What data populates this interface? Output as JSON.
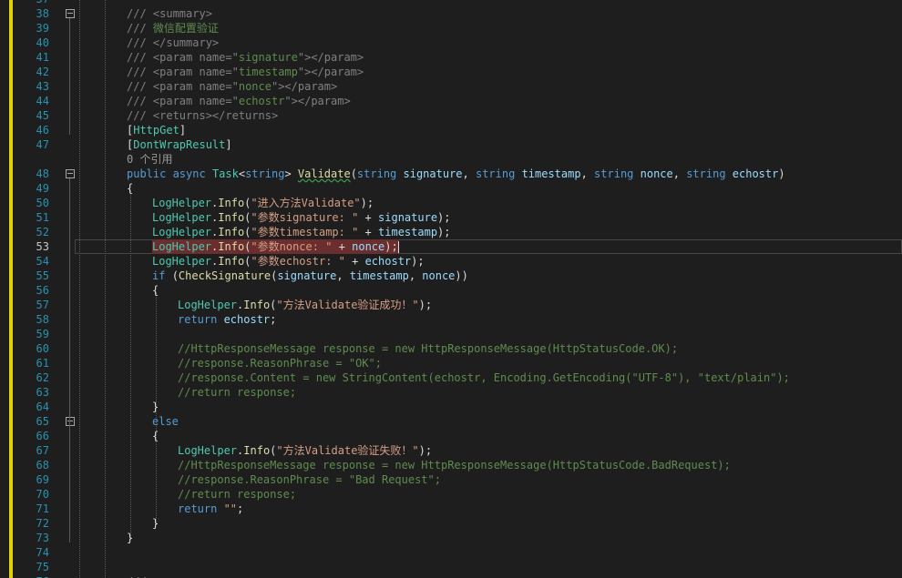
{
  "editor": {
    "language": "C#",
    "current_line": 53,
    "lines": [
      {
        "num": "37",
        "indent": 2,
        "segments": []
      },
      {
        "num": "38",
        "indent": 2,
        "fold": true,
        "segments": [
          {
            "t": "/// ",
            "c": "c-doctag"
          },
          {
            "t": "<summary>",
            "c": "c-doctag"
          }
        ]
      },
      {
        "num": "39",
        "indent": 2,
        "segments": [
          {
            "t": "/// ",
            "c": "c-doctag"
          },
          {
            "t": "微信配置验证",
            "c": "c-doc"
          }
        ]
      },
      {
        "num": "40",
        "indent": 2,
        "segments": [
          {
            "t": "/// ",
            "c": "c-doctag"
          },
          {
            "t": "</summary>",
            "c": "c-doctag"
          }
        ]
      },
      {
        "num": "41",
        "indent": 2,
        "segments": [
          {
            "t": "/// ",
            "c": "c-doctag"
          },
          {
            "t": "<param ",
            "c": "c-doctag"
          },
          {
            "t": "name=",
            "c": "c-doctag"
          },
          {
            "t": "\"",
            "c": "c-doctag"
          },
          {
            "t": "signature",
            "c": "c-doc"
          },
          {
            "t": "\"",
            "c": "c-doctag"
          },
          {
            "t": "></param>",
            "c": "c-doctag"
          }
        ]
      },
      {
        "num": "42",
        "indent": 2,
        "segments": [
          {
            "t": "/// ",
            "c": "c-doctag"
          },
          {
            "t": "<param ",
            "c": "c-doctag"
          },
          {
            "t": "name=",
            "c": "c-doctag"
          },
          {
            "t": "\"",
            "c": "c-doctag"
          },
          {
            "t": "timestamp",
            "c": "c-doc"
          },
          {
            "t": "\"",
            "c": "c-doctag"
          },
          {
            "t": "></param>",
            "c": "c-doctag"
          }
        ]
      },
      {
        "num": "43",
        "indent": 2,
        "segments": [
          {
            "t": "/// ",
            "c": "c-doctag"
          },
          {
            "t": "<param ",
            "c": "c-doctag"
          },
          {
            "t": "name=",
            "c": "c-doctag"
          },
          {
            "t": "\"",
            "c": "c-doctag"
          },
          {
            "t": "nonce",
            "c": "c-doc"
          },
          {
            "t": "\"",
            "c": "c-doctag"
          },
          {
            "t": "></param>",
            "c": "c-doctag"
          }
        ]
      },
      {
        "num": "44",
        "indent": 2,
        "segments": [
          {
            "t": "/// ",
            "c": "c-doctag"
          },
          {
            "t": "<param ",
            "c": "c-doctag"
          },
          {
            "t": "name=",
            "c": "c-doctag"
          },
          {
            "t": "\"",
            "c": "c-doctag"
          },
          {
            "t": "echostr",
            "c": "c-doc"
          },
          {
            "t": "\"",
            "c": "c-doctag"
          },
          {
            "t": "></param>",
            "c": "c-doctag"
          }
        ]
      },
      {
        "num": "45",
        "indent": 2,
        "segments": [
          {
            "t": "/// ",
            "c": "c-doctag"
          },
          {
            "t": "<returns></returns>",
            "c": "c-doctag"
          }
        ]
      },
      {
        "num": "46",
        "indent": 2,
        "segments": [
          {
            "t": "[",
            "c": "c-text"
          },
          {
            "t": "HttpGet",
            "c": "c-attr"
          },
          {
            "t": "]",
            "c": "c-text"
          }
        ]
      },
      {
        "num": "47",
        "indent": 2,
        "segments": [
          {
            "t": "[",
            "c": "c-text"
          },
          {
            "t": "DontWrapResult",
            "c": "c-attr"
          },
          {
            "t": "]",
            "c": "c-text"
          }
        ]
      },
      {
        "num": "",
        "indent": 2,
        "lens": true,
        "segments": [
          {
            "t": "0 个引用",
            "c": "c-lens"
          }
        ]
      },
      {
        "num": "48",
        "indent": 2,
        "fold": true,
        "segments": [
          {
            "t": "public ",
            "c": "c-keyword"
          },
          {
            "t": "async ",
            "c": "c-keyword"
          },
          {
            "t": "Task",
            "c": "c-type"
          },
          {
            "t": "<",
            "c": "c-text"
          },
          {
            "t": "string",
            "c": "c-keyword"
          },
          {
            "t": "> ",
            "c": "c-text"
          },
          {
            "t": "Validate",
            "c": "c-method",
            "sq": true
          },
          {
            "t": "(",
            "c": "c-text"
          },
          {
            "t": "string ",
            "c": "c-keyword"
          },
          {
            "t": "signature",
            "c": "c-ident"
          },
          {
            "t": ", ",
            "c": "c-text"
          },
          {
            "t": "string ",
            "c": "c-keyword"
          },
          {
            "t": "timestamp",
            "c": "c-ident"
          },
          {
            "t": ", ",
            "c": "c-text"
          },
          {
            "t": "string ",
            "c": "c-keyword"
          },
          {
            "t": "nonce",
            "c": "c-ident"
          },
          {
            "t": ", ",
            "c": "c-text"
          },
          {
            "t": "string ",
            "c": "c-keyword"
          },
          {
            "t": "echostr",
            "c": "c-ident"
          },
          {
            "t": ")",
            "c": "c-text"
          }
        ]
      },
      {
        "num": "49",
        "indent": 2,
        "segments": [
          {
            "t": "{",
            "c": "c-text"
          }
        ]
      },
      {
        "num": "50",
        "indent": 3,
        "segments": [
          {
            "t": "LogHelper",
            "c": "c-type"
          },
          {
            "t": ".",
            "c": "c-text"
          },
          {
            "t": "Info",
            "c": "c-method"
          },
          {
            "t": "(",
            "c": "c-text"
          },
          {
            "t": "\"进入方法Validate\"",
            "c": "c-string"
          },
          {
            "t": ");",
            "c": "c-text"
          }
        ]
      },
      {
        "num": "51",
        "indent": 3,
        "segments": [
          {
            "t": "LogHelper",
            "c": "c-type"
          },
          {
            "t": ".",
            "c": "c-text"
          },
          {
            "t": "Info",
            "c": "c-method"
          },
          {
            "t": "(",
            "c": "c-text"
          },
          {
            "t": "\"参数signature: \"",
            "c": "c-string"
          },
          {
            "t": " + ",
            "c": "c-text"
          },
          {
            "t": "signature",
            "c": "c-ident"
          },
          {
            "t": ");",
            "c": "c-text"
          }
        ]
      },
      {
        "num": "52",
        "indent": 3,
        "segments": [
          {
            "t": "LogHelper",
            "c": "c-type"
          },
          {
            "t": ".",
            "c": "c-text"
          },
          {
            "t": "Info",
            "c": "c-method"
          },
          {
            "t": "(",
            "c": "c-text"
          },
          {
            "t": "\"参数timestamp: \"",
            "c": "c-string"
          },
          {
            "t": " + ",
            "c": "c-text"
          },
          {
            "t": "timestamp",
            "c": "c-ident"
          },
          {
            "t": ");",
            "c": "c-text"
          }
        ]
      },
      {
        "num": "53",
        "indent": 3,
        "current": true,
        "segments": [
          {
            "t": "LogHelper",
            "c": "c-type"
          },
          {
            "t": ".",
            "c": "c-text"
          },
          {
            "t": "Info",
            "c": "c-method"
          },
          {
            "t": "(",
            "c": "c-text"
          },
          {
            "t": "\"参数nonce: \"",
            "c": "c-string"
          },
          {
            "t": " + ",
            "c": "c-text"
          },
          {
            "t": "nonce",
            "c": "c-ident"
          },
          {
            "t": ");",
            "c": "c-text"
          }
        ]
      },
      {
        "num": "54",
        "indent": 3,
        "segments": [
          {
            "t": "LogHelper",
            "c": "c-type"
          },
          {
            "t": ".",
            "c": "c-text"
          },
          {
            "t": "Info",
            "c": "c-method"
          },
          {
            "t": "(",
            "c": "c-text"
          },
          {
            "t": "\"参数echostr: \"",
            "c": "c-string"
          },
          {
            "t": " + ",
            "c": "c-text"
          },
          {
            "t": "echostr",
            "c": "c-ident"
          },
          {
            "t": ");",
            "c": "c-text"
          }
        ]
      },
      {
        "num": "55",
        "indent": 3,
        "segments": [
          {
            "t": "if ",
            "c": "c-keyword"
          },
          {
            "t": "(",
            "c": "c-text"
          },
          {
            "t": "CheckSignature",
            "c": "c-method"
          },
          {
            "t": "(",
            "c": "c-text"
          },
          {
            "t": "signature",
            "c": "c-ident"
          },
          {
            "t": ", ",
            "c": "c-text"
          },
          {
            "t": "timestamp",
            "c": "c-ident"
          },
          {
            "t": ", ",
            "c": "c-text"
          },
          {
            "t": "nonce",
            "c": "c-ident"
          },
          {
            "t": "))",
            "c": "c-text"
          }
        ]
      },
      {
        "num": "56",
        "indent": 3,
        "segments": [
          {
            "t": "{",
            "c": "c-text"
          }
        ]
      },
      {
        "num": "57",
        "indent": 4,
        "segments": [
          {
            "t": "LogHelper",
            "c": "c-type"
          },
          {
            "t": ".",
            "c": "c-text"
          },
          {
            "t": "Info",
            "c": "c-method"
          },
          {
            "t": "(",
            "c": "c-text"
          },
          {
            "t": "\"方法Validate验证成功！\"",
            "c": "c-string"
          },
          {
            "t": ");",
            "c": "c-text"
          }
        ]
      },
      {
        "num": "58",
        "indent": 4,
        "segments": [
          {
            "t": "return ",
            "c": "c-keyword"
          },
          {
            "t": "echostr",
            "c": "c-ident"
          },
          {
            "t": ";",
            "c": "c-text"
          }
        ]
      },
      {
        "num": "59",
        "indent": 4,
        "segments": []
      },
      {
        "num": "60",
        "indent": 4,
        "segments": [
          {
            "t": "//HttpResponseMessage response = new HttpResponseMessage(HttpStatusCode.OK);",
            "c": "c-comment"
          }
        ]
      },
      {
        "num": "61",
        "indent": 4,
        "segments": [
          {
            "t": "//response.ReasonPhrase = \"OK\";",
            "c": "c-comment"
          }
        ]
      },
      {
        "num": "62",
        "indent": 4,
        "segments": [
          {
            "t": "//response.Content = new StringContent(echostr, Encoding.GetEncoding(\"UTF-8\"), \"text/plain\");",
            "c": "c-comment"
          }
        ]
      },
      {
        "num": "63",
        "indent": 4,
        "segments": [
          {
            "t": "//return response;",
            "c": "c-comment"
          }
        ]
      },
      {
        "num": "64",
        "indent": 3,
        "segments": [
          {
            "t": "}",
            "c": "c-text"
          }
        ]
      },
      {
        "num": "65",
        "indent": 3,
        "fold": true,
        "segments": [
          {
            "t": "else",
            "c": "c-keyword"
          }
        ]
      },
      {
        "num": "66",
        "indent": 3,
        "segments": [
          {
            "t": "{",
            "c": "c-text"
          }
        ]
      },
      {
        "num": "67",
        "indent": 4,
        "segments": [
          {
            "t": "LogHelper",
            "c": "c-type"
          },
          {
            "t": ".",
            "c": "c-text"
          },
          {
            "t": "Info",
            "c": "c-method"
          },
          {
            "t": "(",
            "c": "c-text"
          },
          {
            "t": "\"方法Validate验证失败！\"",
            "c": "c-string"
          },
          {
            "t": ");",
            "c": "c-text"
          }
        ]
      },
      {
        "num": "68",
        "indent": 4,
        "segments": [
          {
            "t": "//HttpResponseMessage response = new HttpResponseMessage(HttpStatusCode.BadRequest);",
            "c": "c-comment"
          }
        ]
      },
      {
        "num": "69",
        "indent": 4,
        "segments": [
          {
            "t": "//response.ReasonPhrase = \"Bad Request\";",
            "c": "c-comment"
          }
        ]
      },
      {
        "num": "70",
        "indent": 4,
        "segments": [
          {
            "t": "//return response;",
            "c": "c-comment"
          }
        ]
      },
      {
        "num": "71",
        "indent": 4,
        "segments": [
          {
            "t": "return ",
            "c": "c-keyword"
          },
          {
            "t": "\"\"",
            "c": "c-string"
          },
          {
            "t": ";",
            "c": "c-text"
          }
        ]
      },
      {
        "num": "72",
        "indent": 3,
        "segments": [
          {
            "t": "}",
            "c": "c-text"
          }
        ]
      },
      {
        "num": "73",
        "indent": 2,
        "segments": [
          {
            "t": "}",
            "c": "c-text"
          }
        ]
      },
      {
        "num": "74",
        "indent": 2,
        "segments": []
      },
      {
        "num": "75",
        "indent": 2,
        "segments": []
      },
      {
        "num": "76",
        "indent": 2,
        "segments": [
          {
            "t": "/// <summary>",
            "c": "c-doctag"
          }
        ]
      }
    ]
  }
}
